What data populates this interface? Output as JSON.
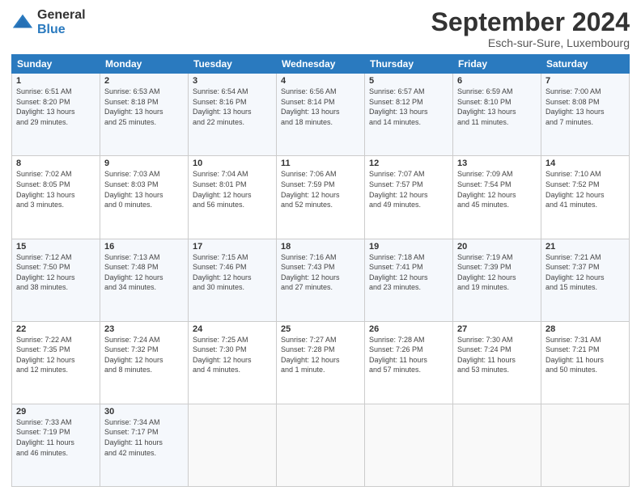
{
  "header": {
    "logo_general": "General",
    "logo_blue": "Blue",
    "month_title": "September 2024",
    "location": "Esch-sur-Sure, Luxembourg"
  },
  "days_of_week": [
    "Sunday",
    "Monday",
    "Tuesday",
    "Wednesday",
    "Thursday",
    "Friday",
    "Saturday"
  ],
  "weeks": [
    [
      {
        "day": "1",
        "info": "Sunrise: 6:51 AM\nSunset: 8:20 PM\nDaylight: 13 hours\nand 29 minutes."
      },
      {
        "day": "2",
        "info": "Sunrise: 6:53 AM\nSunset: 8:18 PM\nDaylight: 13 hours\nand 25 minutes."
      },
      {
        "day": "3",
        "info": "Sunrise: 6:54 AM\nSunset: 8:16 PM\nDaylight: 13 hours\nand 22 minutes."
      },
      {
        "day": "4",
        "info": "Sunrise: 6:56 AM\nSunset: 8:14 PM\nDaylight: 13 hours\nand 18 minutes."
      },
      {
        "day": "5",
        "info": "Sunrise: 6:57 AM\nSunset: 8:12 PM\nDaylight: 13 hours\nand 14 minutes."
      },
      {
        "day": "6",
        "info": "Sunrise: 6:59 AM\nSunset: 8:10 PM\nDaylight: 13 hours\nand 11 minutes."
      },
      {
        "day": "7",
        "info": "Sunrise: 7:00 AM\nSunset: 8:08 PM\nDaylight: 13 hours\nand 7 minutes."
      }
    ],
    [
      {
        "day": "8",
        "info": "Sunrise: 7:02 AM\nSunset: 8:05 PM\nDaylight: 13 hours\nand 3 minutes."
      },
      {
        "day": "9",
        "info": "Sunrise: 7:03 AM\nSunset: 8:03 PM\nDaylight: 13 hours\nand 0 minutes."
      },
      {
        "day": "10",
        "info": "Sunrise: 7:04 AM\nSunset: 8:01 PM\nDaylight: 12 hours\nand 56 minutes."
      },
      {
        "day": "11",
        "info": "Sunrise: 7:06 AM\nSunset: 7:59 PM\nDaylight: 12 hours\nand 52 minutes."
      },
      {
        "day": "12",
        "info": "Sunrise: 7:07 AM\nSunset: 7:57 PM\nDaylight: 12 hours\nand 49 minutes."
      },
      {
        "day": "13",
        "info": "Sunrise: 7:09 AM\nSunset: 7:54 PM\nDaylight: 12 hours\nand 45 minutes."
      },
      {
        "day": "14",
        "info": "Sunrise: 7:10 AM\nSunset: 7:52 PM\nDaylight: 12 hours\nand 41 minutes."
      }
    ],
    [
      {
        "day": "15",
        "info": "Sunrise: 7:12 AM\nSunset: 7:50 PM\nDaylight: 12 hours\nand 38 minutes."
      },
      {
        "day": "16",
        "info": "Sunrise: 7:13 AM\nSunset: 7:48 PM\nDaylight: 12 hours\nand 34 minutes."
      },
      {
        "day": "17",
        "info": "Sunrise: 7:15 AM\nSunset: 7:46 PM\nDaylight: 12 hours\nand 30 minutes."
      },
      {
        "day": "18",
        "info": "Sunrise: 7:16 AM\nSunset: 7:43 PM\nDaylight: 12 hours\nand 27 minutes."
      },
      {
        "day": "19",
        "info": "Sunrise: 7:18 AM\nSunset: 7:41 PM\nDaylight: 12 hours\nand 23 minutes."
      },
      {
        "day": "20",
        "info": "Sunrise: 7:19 AM\nSunset: 7:39 PM\nDaylight: 12 hours\nand 19 minutes."
      },
      {
        "day": "21",
        "info": "Sunrise: 7:21 AM\nSunset: 7:37 PM\nDaylight: 12 hours\nand 15 minutes."
      }
    ],
    [
      {
        "day": "22",
        "info": "Sunrise: 7:22 AM\nSunset: 7:35 PM\nDaylight: 12 hours\nand 12 minutes."
      },
      {
        "day": "23",
        "info": "Sunrise: 7:24 AM\nSunset: 7:32 PM\nDaylight: 12 hours\nand 8 minutes."
      },
      {
        "day": "24",
        "info": "Sunrise: 7:25 AM\nSunset: 7:30 PM\nDaylight: 12 hours\nand 4 minutes."
      },
      {
        "day": "25",
        "info": "Sunrise: 7:27 AM\nSunset: 7:28 PM\nDaylight: 12 hours\nand 1 minute."
      },
      {
        "day": "26",
        "info": "Sunrise: 7:28 AM\nSunset: 7:26 PM\nDaylight: 11 hours\nand 57 minutes."
      },
      {
        "day": "27",
        "info": "Sunrise: 7:30 AM\nSunset: 7:24 PM\nDaylight: 11 hours\nand 53 minutes."
      },
      {
        "day": "28",
        "info": "Sunrise: 7:31 AM\nSunset: 7:21 PM\nDaylight: 11 hours\nand 50 minutes."
      }
    ],
    [
      {
        "day": "29",
        "info": "Sunrise: 7:33 AM\nSunset: 7:19 PM\nDaylight: 11 hours\nand 46 minutes."
      },
      {
        "day": "30",
        "info": "Sunrise: 7:34 AM\nSunset: 7:17 PM\nDaylight: 11 hours\nand 42 minutes."
      },
      {
        "day": "",
        "info": ""
      },
      {
        "day": "",
        "info": ""
      },
      {
        "day": "",
        "info": ""
      },
      {
        "day": "",
        "info": ""
      },
      {
        "day": "",
        "info": ""
      }
    ]
  ]
}
